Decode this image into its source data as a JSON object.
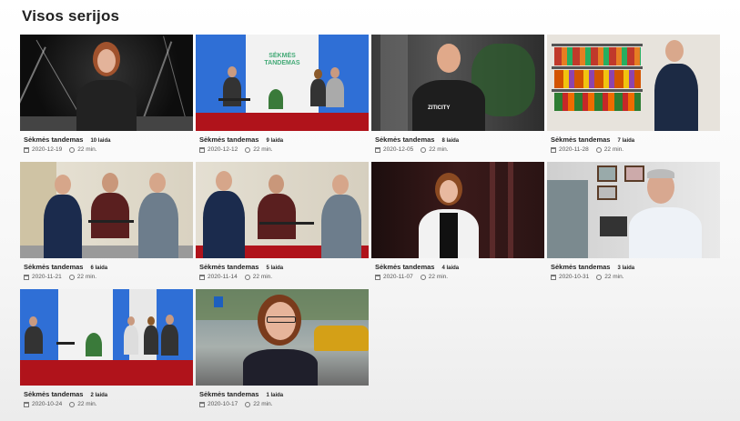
{
  "page": {
    "title": "Visos serijos"
  },
  "episodes": [
    {
      "title": "Sėkmės tandemas",
      "episode": "10 laida",
      "date": "2020-12-19",
      "duration": "22 min.",
      "scene": "studio-dark-woman"
    },
    {
      "title": "Sėkmės tandemas",
      "episode": "9 laida",
      "date": "2020-12-12",
      "duration": "22 min.",
      "scene": "studio-blue-set",
      "logo_text": "SĖKMĖS TANDEMAS"
    },
    {
      "title": "Sėkmės tandemas",
      "episode": "8 laida",
      "date": "2020-12-05",
      "duration": "22 min.",
      "scene": "office-man",
      "shirt_text": "ZITICITY"
    },
    {
      "title": "Sėkmės tandemas",
      "episode": "7 laida",
      "date": "2020-11-28",
      "duration": "22 min.",
      "scene": "shop-shelves"
    },
    {
      "title": "Sėkmės tandemas",
      "episode": "6 laida",
      "date": "2020-11-21",
      "duration": "22 min.",
      "scene": "studio-three-men"
    },
    {
      "title": "Sėkmės tandemas",
      "episode": "5 laida",
      "date": "2020-11-14",
      "duration": "22 min.",
      "scene": "studio-three-men-b"
    },
    {
      "title": "Sėkmės tandemas",
      "episode": "4 laida",
      "date": "2020-11-07",
      "duration": "22 min.",
      "scene": "dark-woman-white"
    },
    {
      "title": "Sėkmės tandemas",
      "episode": "3 laida",
      "date": "2020-10-31",
      "duration": "22 min.",
      "scene": "office-old-man"
    },
    {
      "title": "Sėkmės tandemas",
      "episode": "2 laida",
      "date": "2020-10-24",
      "duration": "22 min.",
      "scene": "studio-blue-wide"
    },
    {
      "title": "Sėkmės tandemas",
      "episode": "1 laida",
      "date": "2020-10-17",
      "duration": "22 min.",
      "scene": "street-woman"
    }
  ],
  "icons": {
    "date": "calendar-icon",
    "duration": "clock-icon"
  },
  "colors": {
    "text": "#222222",
    "meta": "#555555",
    "studio_red": "#b0131b",
    "studio_blue": "#2f6fd6"
  }
}
